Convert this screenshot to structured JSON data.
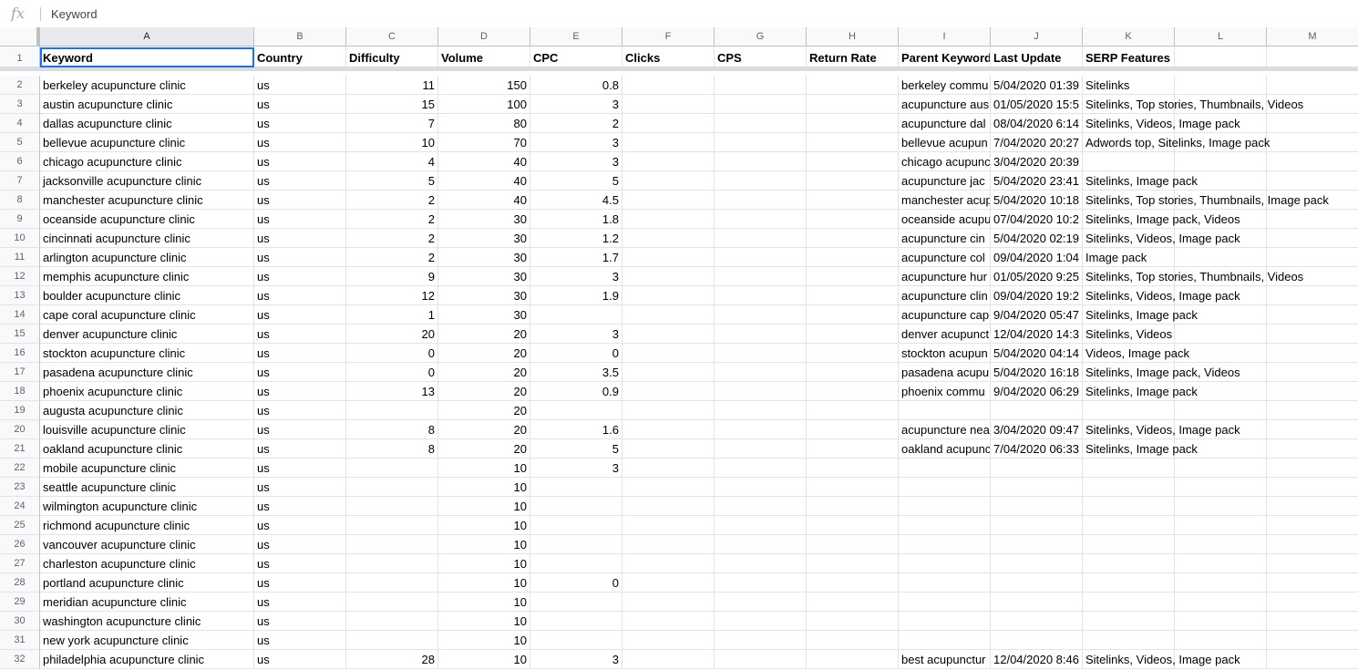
{
  "formula_bar": {
    "fx_label": "fx",
    "value": "Keyword"
  },
  "column_letters": [
    "A",
    "B",
    "C",
    "D",
    "E",
    "F",
    "G",
    "H",
    "I",
    "J",
    "K",
    "L",
    "M"
  ],
  "header_row": {
    "row_number": "1",
    "cells": [
      "Keyword",
      "Country",
      "Difficulty",
      "Volume",
      "CPC",
      "Clicks",
      "CPS",
      "Return Rate",
      "Parent Keyword",
      "Last Update",
      "SERP Features",
      "",
      ""
    ]
  },
  "rows": [
    {
      "n": "2",
      "a": "berkeley acupuncture clinic",
      "b": "us",
      "c": "11",
      "d": "150",
      "e": "0.8",
      "i": "berkeley commu",
      "j": "5/04/2020 01:39",
      "k": "Sitelinks"
    },
    {
      "n": "3",
      "a": "austin acupuncture clinic",
      "b": "us",
      "c": "15",
      "d": "100",
      "e": "3",
      "i": "acupuncture aus",
      "j": "01/05/2020 15:5",
      "k": "Sitelinks, Top stories, Thumbnails, Videos"
    },
    {
      "n": "4",
      "a": "dallas acupuncture clinic",
      "b": "us",
      "c": "7",
      "d": "80",
      "e": "2",
      "i": "acupuncture dal",
      "j": "08/04/2020 6:14",
      "k": "Sitelinks, Videos, Image pack"
    },
    {
      "n": "5",
      "a": "bellevue acupuncture clinic",
      "b": "us",
      "c": "10",
      "d": "70",
      "e": "3",
      "i": "bellevue acupun",
      "j": "7/04/2020 20:27",
      "k": "Adwords top, Sitelinks, Image pack"
    },
    {
      "n": "6",
      "a": "chicago acupuncture clinic",
      "b": "us",
      "c": "4",
      "d": "40",
      "e": "3",
      "i": "chicago acupunc",
      "j": "3/04/2020 20:39",
      "k": ""
    },
    {
      "n": "7",
      "a": "jacksonville acupuncture clinic",
      "b": "us",
      "c": "5",
      "d": "40",
      "e": "5",
      "i": "acupuncture jac",
      "j": "5/04/2020 23:41",
      "k": "Sitelinks, Image pack"
    },
    {
      "n": "8",
      "a": "manchester acupuncture clinic",
      "b": "us",
      "c": "2",
      "d": "40",
      "e": "4.5",
      "i": "manchester acup",
      "j": "5/04/2020 10:18",
      "k": "Sitelinks, Top stories, Thumbnails, Image pack"
    },
    {
      "n": "9",
      "a": "oceanside acupuncture clinic",
      "b": "us",
      "c": "2",
      "d": "30",
      "e": "1.8",
      "i": "oceanside acupu",
      "j": "07/04/2020 10:2",
      "k": "Sitelinks, Image pack, Videos"
    },
    {
      "n": "10",
      "a": "cincinnati acupuncture clinic",
      "b": "us",
      "c": "2",
      "d": "30",
      "e": "1.2",
      "i": "acupuncture cin",
      "j": "5/04/2020 02:19",
      "k": "Sitelinks, Videos, Image pack"
    },
    {
      "n": "11",
      "a": "arlington acupuncture clinic",
      "b": "us",
      "c": "2",
      "d": "30",
      "e": "1.7",
      "i": "acupuncture col",
      "j": "09/04/2020 1:04",
      "k": "Image pack"
    },
    {
      "n": "12",
      "a": "memphis acupuncture clinic",
      "b": "us",
      "c": "9",
      "d": "30",
      "e": "3",
      "i": "acupuncture hur",
      "j": "01/05/2020 9:25",
      "k": "Sitelinks, Top stories, Thumbnails, Videos"
    },
    {
      "n": "13",
      "a": "boulder acupuncture clinic",
      "b": "us",
      "c": "12",
      "d": "30",
      "e": "1.9",
      "i": "acupuncture clin",
      "j": "09/04/2020 19:2",
      "k": "Sitelinks, Videos, Image pack"
    },
    {
      "n": "14",
      "a": "cape coral acupuncture clinic",
      "b": "us",
      "c": "1",
      "d": "30",
      "e": "",
      "i": "acupuncture cap",
      "j": "9/04/2020 05:47",
      "k": "Sitelinks, Image pack"
    },
    {
      "n": "15",
      "a": "denver acupuncture clinic",
      "b": "us",
      "c": "20",
      "d": "20",
      "e": "3",
      "i": "denver acupunct",
      "j": "12/04/2020 14:3",
      "k": "Sitelinks, Videos"
    },
    {
      "n": "16",
      "a": "stockton acupuncture clinic",
      "b": "us",
      "c": "0",
      "d": "20",
      "e": "0",
      "i": "stockton acupun",
      "j": "5/04/2020 04:14",
      "k": "Videos, Image pack"
    },
    {
      "n": "17",
      "a": "pasadena acupuncture clinic",
      "b": "us",
      "c": "0",
      "d": "20",
      "e": "3.5",
      "i": "pasadena acupu",
      "j": "5/04/2020 16:18",
      "k": "Sitelinks, Image pack, Videos"
    },
    {
      "n": "18",
      "a": "phoenix acupuncture clinic",
      "b": "us",
      "c": "13",
      "d": "20",
      "e": "0.9",
      "i": "phoenix commu",
      "j": "9/04/2020 06:29",
      "k": "Sitelinks, Image pack"
    },
    {
      "n": "19",
      "a": "augusta acupuncture clinic",
      "b": "us",
      "c": "",
      "d": "20",
      "e": "",
      "i": "",
      "j": "",
      "k": ""
    },
    {
      "n": "20",
      "a": "louisville acupuncture clinic",
      "b": "us",
      "c": "8",
      "d": "20",
      "e": "1.6",
      "i": "acupuncture nea",
      "j": "3/04/2020 09:47",
      "k": "Sitelinks, Videos, Image pack"
    },
    {
      "n": "21",
      "a": "oakland acupuncture clinic",
      "b": "us",
      "c": "8",
      "d": "20",
      "e": "5",
      "i": "oakland acupunc",
      "j": "7/04/2020 06:33",
      "k": "Sitelinks, Image pack"
    },
    {
      "n": "22",
      "a": "mobile acupuncture clinic",
      "b": "us",
      "c": "",
      "d": "10",
      "e": "3",
      "i": "",
      "j": "",
      "k": ""
    },
    {
      "n": "23",
      "a": "seattle acupuncture clinic",
      "b": "us",
      "c": "",
      "d": "10",
      "e": "",
      "i": "",
      "j": "",
      "k": ""
    },
    {
      "n": "24",
      "a": "wilmington acupuncture clinic",
      "b": "us",
      "c": "",
      "d": "10",
      "e": "",
      "i": "",
      "j": "",
      "k": ""
    },
    {
      "n": "25",
      "a": "richmond acupuncture clinic",
      "b": "us",
      "c": "",
      "d": "10",
      "e": "",
      "i": "",
      "j": "",
      "k": ""
    },
    {
      "n": "26",
      "a": "vancouver acupuncture clinic",
      "b": "us",
      "c": "",
      "d": "10",
      "e": "",
      "i": "",
      "j": "",
      "k": ""
    },
    {
      "n": "27",
      "a": "charleston acupuncture clinic",
      "b": "us",
      "c": "",
      "d": "10",
      "e": "",
      "i": "",
      "j": "",
      "k": ""
    },
    {
      "n": "28",
      "a": "portland acupuncture clinic",
      "b": "us",
      "c": "",
      "d": "10",
      "e": "0",
      "i": "",
      "j": "",
      "k": ""
    },
    {
      "n": "29",
      "a": "meridian acupuncture clinic",
      "b": "us",
      "c": "",
      "d": "10",
      "e": "",
      "i": "",
      "j": "",
      "k": ""
    },
    {
      "n": "30",
      "a": "washington acupuncture clinic",
      "b": "us",
      "c": "",
      "d": "10",
      "e": "",
      "i": "",
      "j": "",
      "k": ""
    },
    {
      "n": "31",
      "a": "new york acupuncture clinic",
      "b": "us",
      "c": "",
      "d": "10",
      "e": "",
      "i": "",
      "j": "",
      "k": ""
    },
    {
      "n": "32",
      "a": "philadelphia acupuncture clinic",
      "b": "us",
      "c": "28",
      "d": "10",
      "e": "3",
      "i": "best acupunctur",
      "j": "12/04/2020 8:46",
      "k": "Sitelinks, Videos, Image pack"
    }
  ],
  "selection": {
    "cell": "A1"
  }
}
